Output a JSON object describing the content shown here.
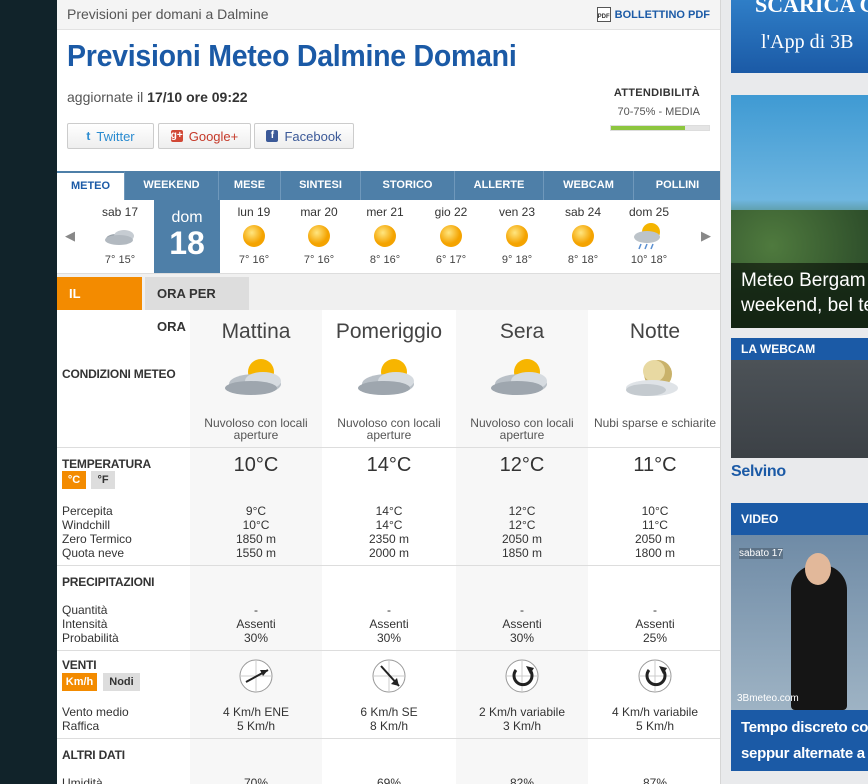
{
  "breadcrumb": "Previsioni per domani a Dalmine",
  "pdf": {
    "icon": "pdf-icon",
    "icon_text": "PDF",
    "label": "BOLLETTINO PDF"
  },
  "title": "Previsioni Meteo Dalmine Domani",
  "updated": {
    "prefix": "aggiornate il ",
    "value": "17/10 ore 09:22"
  },
  "reliability": {
    "label": "ATTENDIBILITÀ",
    "value": "70-75% - MEDIA",
    "fill": 0.75
  },
  "social": [
    {
      "label": "Twitter",
      "icon": "twitter-icon",
      "icon_text": "t"
    },
    {
      "label": "Google+",
      "icon": "google-plus-icon",
      "icon_text": "g+"
    },
    {
      "label": "Facebook",
      "icon": "facebook-icon",
      "icon_text": "f"
    }
  ],
  "tabs": [
    "METEO",
    "WEEKEND",
    "MESE",
    "SINTESI",
    "STORICO",
    "ALLERTE",
    "WEBCAM",
    "POLLINI"
  ],
  "days": [
    {
      "name": "sab 17",
      "temps": "7° 15°",
      "icon": "cloudy-icon"
    },
    {
      "name": "dom",
      "num": "18",
      "selected": true
    },
    {
      "name": "lun 19",
      "temps": "7° 16°",
      "icon": "sun-icon"
    },
    {
      "name": "mar 20",
      "temps": "7° 16°",
      "icon": "sun-icon"
    },
    {
      "name": "mer 21",
      "temps": "8° 16°",
      "icon": "sun-icon"
    },
    {
      "name": "gio 22",
      "temps": "6° 17°",
      "icon": "sun-icon"
    },
    {
      "name": "ven 23",
      "temps": "9° 18°",
      "icon": "sun-icon"
    },
    {
      "name": "sab 24",
      "temps": "8° 18°",
      "icon": "sun-icon"
    },
    {
      "name": "dom 25",
      "temps": "10° 18°",
      "icon": "rain-sun-icon"
    }
  ],
  "subtabs": [
    "IL GIORNO",
    "ORA PER ORA"
  ],
  "labels": {
    "conditions": "CONDIZIONI METEO",
    "temperature": "TEMPERATURA",
    "celsius": "°C",
    "fahrenheit": "°F",
    "perceived": "Percepita",
    "windchill": "Windchill",
    "zero": "Zero Termico",
    "snow": "Quota neve",
    "precip": "PRECIPITAZIONI",
    "quantity": "Quantità",
    "intensity": "Intensità",
    "probability": "Probabilità",
    "wind": "VENTI",
    "kmh": "Km/h",
    "knots": "Nodi",
    "wind_avg": "Vento medio",
    "gust": "Raffica",
    "other": "ALTRI DATI",
    "humidity": "Umidità"
  },
  "periods": [
    {
      "name": "Mattina",
      "cond": "Nuvoloso con locali aperture",
      "icon": "partly-cloudy-icon",
      "temp": "10°C",
      "perceived": "9°C",
      "windchill": "10°C",
      "zero": "1850 m",
      "snow": "1550 m",
      "qty": "-",
      "intensity": "Assenti",
      "prob": "30%",
      "wind": "4 Km/h  ENE",
      "gust": "5 Km/h",
      "wind_icon": "wind-ene-icon",
      "humidity": "70%"
    },
    {
      "name": "Pomeriggio",
      "cond": "Nuvoloso con locali aperture",
      "icon": "partly-cloudy-icon",
      "temp": "14°C",
      "perceived": "14°C",
      "windchill": "14°C",
      "zero": "2350 m",
      "snow": "2000 m",
      "qty": "-",
      "intensity": "Assenti",
      "prob": "30%",
      "wind": "6 Km/h  SE",
      "gust": "8 Km/h",
      "wind_icon": "wind-se-icon",
      "humidity": "69%"
    },
    {
      "name": "Sera",
      "cond": "Nuvoloso con locali aperture",
      "icon": "partly-cloudy-icon",
      "temp": "12°C",
      "perceived": "12°C",
      "windchill": "12°C",
      "zero": "2050 m",
      "snow": "1850 m",
      "qty": "-",
      "intensity": "Assenti",
      "prob": "30%",
      "wind": "2 Km/h  variabile",
      "gust": "3 Km/h",
      "wind_icon": "wind-variable-icon",
      "humidity": "82%"
    },
    {
      "name": "Notte",
      "cond": "Nubi sparse e schiarite",
      "icon": "moon-cloud-icon",
      "temp": "11°C",
      "perceived": "10°C",
      "windchill": "11°C",
      "zero": "2050 m",
      "snow": "1800 m",
      "qty": "-",
      "intensity": "Assenti",
      "prob": "25%",
      "wind": "4 Km/h  variabile",
      "gust": "5 Km/h",
      "wind_icon": "wind-variable-icon",
      "humidity": "87%"
    }
  ],
  "sidebar": {
    "banner": {
      "line1": "SCARICA G",
      "line2": "l'App di 3B"
    },
    "news": {
      "line1": "Meteo Bergam",
      "line2": "weekend, bel te"
    },
    "webcam": {
      "head": "LA WEBCAM",
      "caption": "Selvino"
    },
    "video": {
      "head": "VIDEO",
      "date": "sabato 17",
      "brand": "3Bmeteo.com",
      "line1": "Tempo discreto con",
      "line2": "seppur alternate a n"
    }
  },
  "colors": {
    "brand": "#1b5aa6",
    "tab_bar": "#4e7fa8",
    "accent": "#f38b00"
  }
}
